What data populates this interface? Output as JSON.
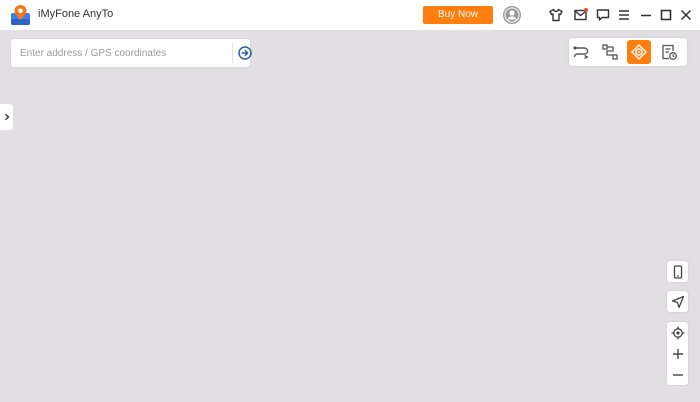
{
  "app": {
    "title": "iMyFone AnyTo",
    "buy_label": "Buy Now",
    "accent": "#ff7e0f"
  },
  "titlebar_icons": [
    {
      "name": "tshirt-icon"
    },
    {
      "name": "mail-icon",
      "has_notification": true
    },
    {
      "name": "feedback-icon"
    },
    {
      "name": "menu-icon"
    },
    {
      "name": "minimize-icon"
    },
    {
      "name": "maximize-icon"
    },
    {
      "name": "close-icon"
    }
  ],
  "search": {
    "placeholder": "Enter address / GPS coordinates",
    "value": ""
  },
  "modes": [
    {
      "name": "two-spot-mode-icon",
      "active": false
    },
    {
      "name": "multi-spot-mode-icon",
      "active": false
    },
    {
      "name": "teleport-mode-icon",
      "active": true
    },
    {
      "name": "history-records-icon",
      "active": false
    }
  ],
  "map_controls": [
    {
      "name": "device-icon"
    },
    {
      "name": "navigate-icon"
    },
    {
      "name": "locate-icon"
    },
    {
      "name": "zoom-in-icon"
    },
    {
      "name": "zoom-out-icon"
    }
  ]
}
